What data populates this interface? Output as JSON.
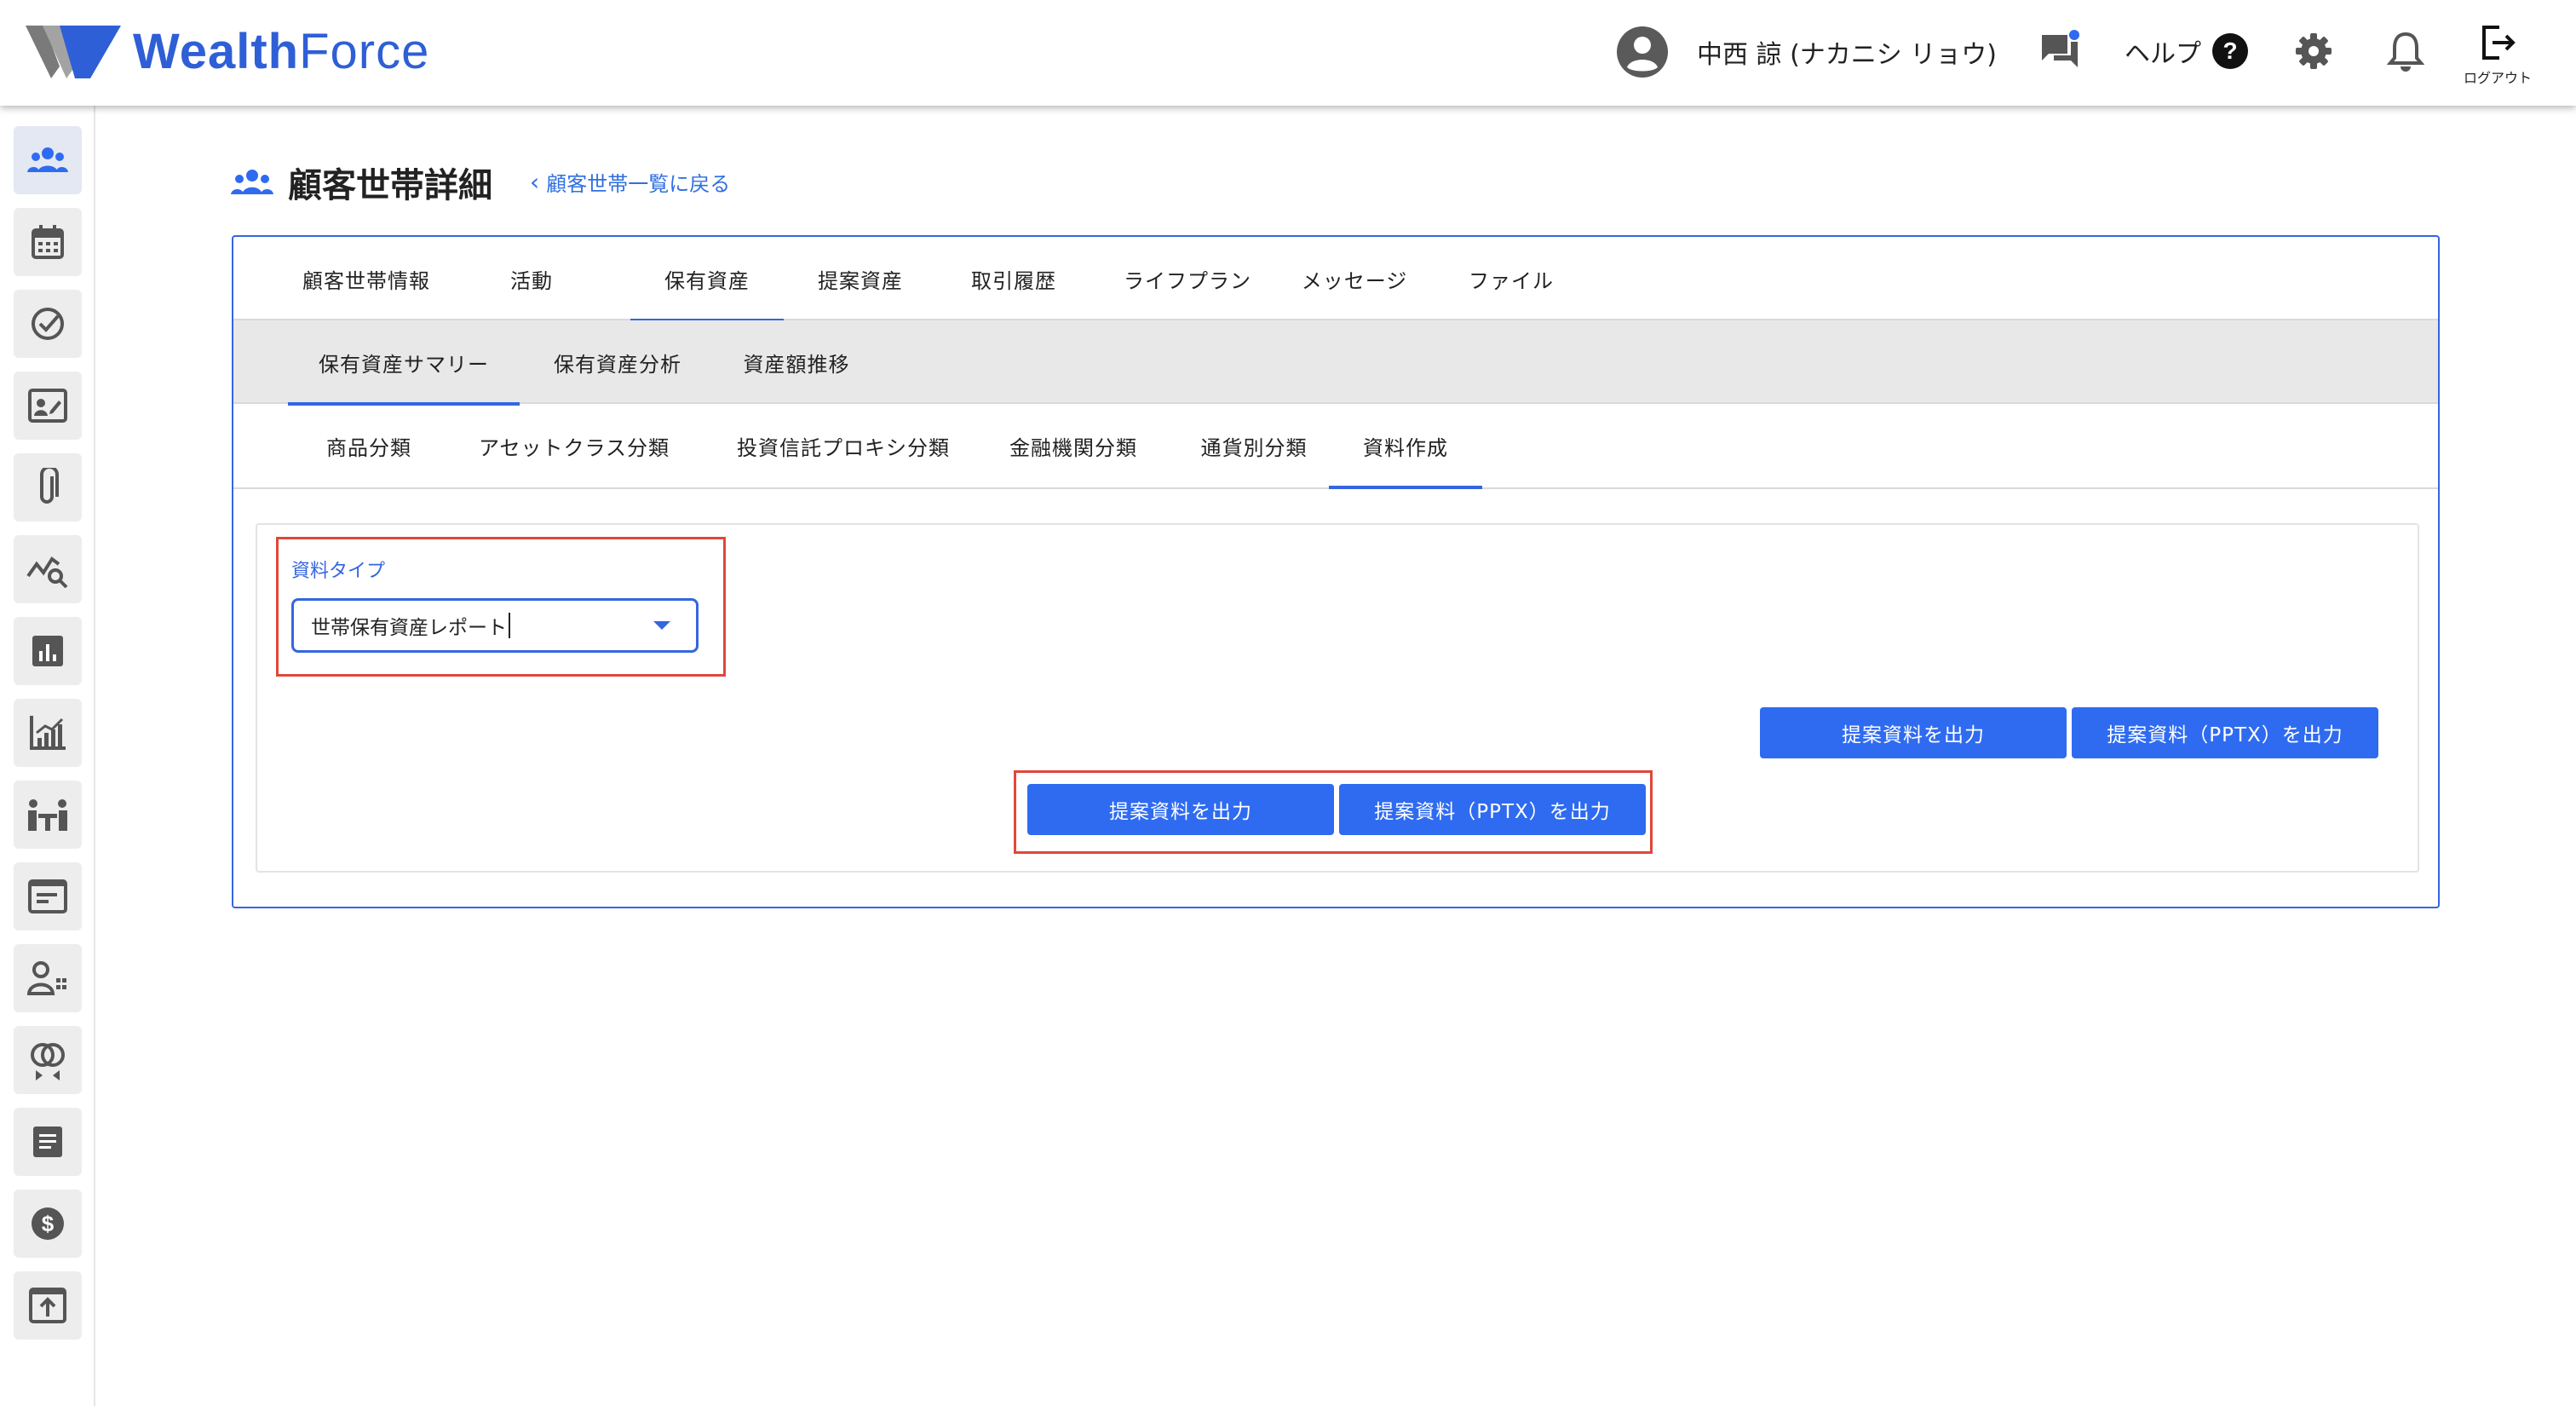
{
  "header": {
    "brand": {
      "left": "Wealth",
      "right": "Force"
    },
    "user_name": "中西 諒 (ナカニシ リョウ)",
    "help_label": "ヘルプ",
    "logout_label": "ログアウト"
  },
  "page": {
    "title": "顧客世帯詳細",
    "back_link": "顧客世帯一覧に戻る"
  },
  "tabs_primary": [
    "顧客世帯情報",
    "活動",
    "保有資産",
    "提案資産",
    "取引履歴",
    "ライフプラン",
    "メッセージ",
    "ファイル"
  ],
  "tabs_secondary": [
    "保有資産サマリー",
    "保有資産分析",
    "資産額推移"
  ],
  "tabs_tertiary": [
    "商品分類",
    "アセットクラス分類",
    "投資信託プロキシ分類",
    "金融機関分類",
    "通貨別分類",
    "資料作成"
  ],
  "form": {
    "label": "資料タイプ",
    "selected_value": "世帯保有資産レポート"
  },
  "buttons": {
    "export_label": "提案資料を出力",
    "export_pptx_label": "提案資料（PPTX）を出力"
  },
  "colors": {
    "accent": "#2f6bf0",
    "brand": "#2f5fd6",
    "highlight": "#e0473a"
  },
  "sidebar_icons": [
    "group-icon",
    "calendar-icon",
    "check-circle-icon",
    "contact-card-icon",
    "paperclip-icon",
    "chart-search-icon",
    "bar-chart-icon",
    "growth-chart-icon",
    "meeting-icon",
    "window-icon",
    "person-list-icon",
    "rings-icon",
    "document-icon",
    "dollar-icon",
    "upload-icon"
  ]
}
